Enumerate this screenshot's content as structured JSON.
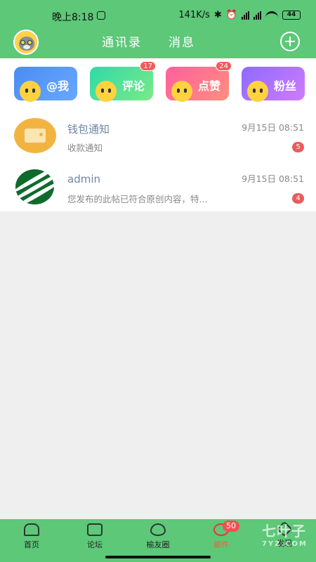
{
  "status_bar": {
    "time": "晚上8:18",
    "network_speed": "141K/s",
    "battery": "44"
  },
  "header": {
    "tab_contacts": "通讯录",
    "tab_messages": "消息"
  },
  "tiles": [
    {
      "label": "@我",
      "badge": ""
    },
    {
      "label": "评论",
      "badge": "17"
    },
    {
      "label": "点赞",
      "badge": "24"
    },
    {
      "label": "粉丝",
      "badge": ""
    }
  ],
  "conversations": [
    {
      "title": "钱包通知",
      "preview": "收款通知",
      "time": "9月15日 08:51",
      "unread": "5"
    },
    {
      "title": "admin",
      "preview": "您发布的此帖已符合原创内容，特...",
      "time": "9月15日 08:51",
      "unread": "4"
    }
  ],
  "bottom_nav": {
    "home": "首页",
    "forum": "论坛",
    "circle": "榆友圈",
    "center_label": "邮件",
    "center_badge": "50",
    "discover": "发现"
  },
  "watermark": {
    "brand": "七叶子",
    "site": "7YZ.COM"
  },
  "colors": {
    "brand_green": "#5cc878",
    "badge_red": "#ea5b5b"
  }
}
